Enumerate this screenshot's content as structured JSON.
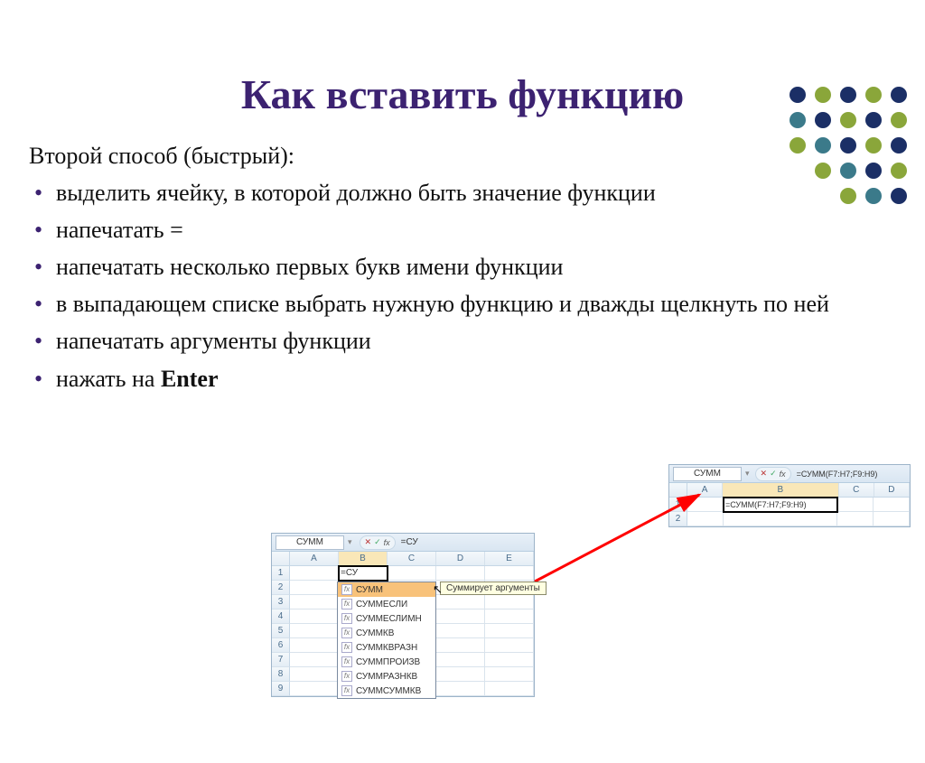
{
  "title": "Как вставить функцию",
  "intro": "Второй способ (быстрый):",
  "bullets": [
    "выделить ячейку, в которой должно быть значение функции",
    "напечатать =",
    "напечатать несколько первых букв имени функции",
    "в выпадающем списке выбрать нужную функцию и дважды щелкнуть по ней",
    "напечатать аргументы функции",
    "нажать на "
  ],
  "enter_word": "Enter",
  "excel1": {
    "namebox": "СУММ",
    "formula_bar": "=СУ",
    "columns": [
      "A",
      "B",
      "C",
      "D",
      "E"
    ],
    "rows": [
      "1",
      "2",
      "3",
      "4",
      "5",
      "6",
      "7",
      "8",
      "9"
    ],
    "cell_value": "=СУ",
    "dropdown": [
      "СУММ",
      "СУММЕСЛИ",
      "СУММЕСЛИМН",
      "СУММКВ",
      "СУММКВРАЗН",
      "СУММПРОИЗВ",
      "СУММРАЗНКВ",
      "СУММСУММКВ"
    ],
    "tooltip": "Суммирует аргументы"
  },
  "excel2": {
    "namebox": "СУММ",
    "formula_bar": "=СУММ(F7:H7;F9:H9)",
    "columns": [
      "A",
      "B",
      "C",
      "D"
    ],
    "cell_value": "=СУММ(F7:H7;F9:H9)"
  },
  "deco_colors": {
    "olive": "#8aa63a",
    "navy": "#1b2f66",
    "teal": "#3b7a8a"
  }
}
